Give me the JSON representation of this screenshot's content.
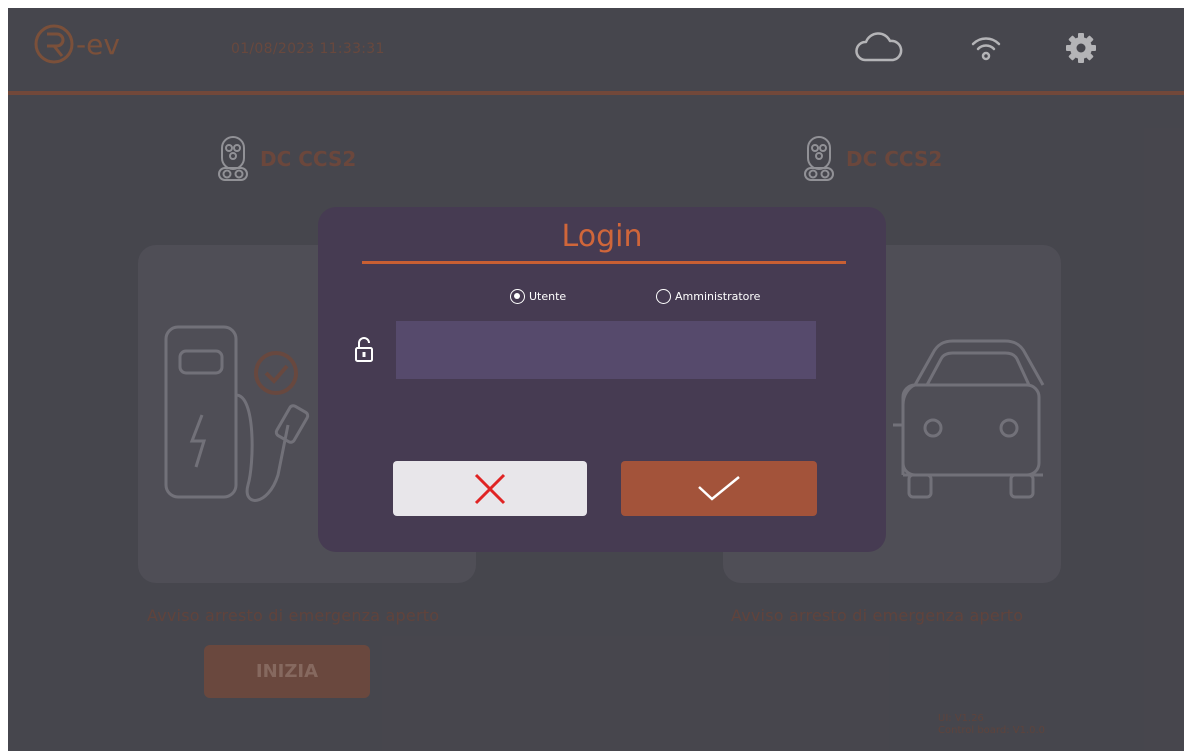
{
  "header": {
    "logo_text": "-ev",
    "datetime": "01/08/2023  11:33:31",
    "icons": [
      "cloud-icon",
      "wifi-icon",
      "gear-icon"
    ]
  },
  "connectors": [
    {
      "label": "DC CCS2",
      "icon": "ccs2-plug-icon",
      "illustration": "charging-station-icon",
      "warning": "Avviso arresto di emergenza aperto",
      "start_label": "INIZIA"
    },
    {
      "label": "DC CCS2",
      "icon": "ccs2-plug-icon",
      "illustration": "car-icon",
      "warning": "Avviso arresto di emergenza aperto"
    }
  ],
  "footer": {
    "ui_version": "UI: V1.26",
    "board_version": "Control board: V1.0.0"
  },
  "login": {
    "title": "Login",
    "options": [
      {
        "label": "Utente",
        "selected": true
      },
      {
        "label": "Amministratore",
        "selected": false
      }
    ],
    "password_value": "",
    "cancel_icon": "close-icon",
    "confirm_icon": "check-icon"
  },
  "colors": {
    "accent": "#c85f33",
    "background": "#57565c",
    "dialog": "#463b52",
    "confirm": "#a3533a",
    "cancel": "#e8e6ea"
  }
}
